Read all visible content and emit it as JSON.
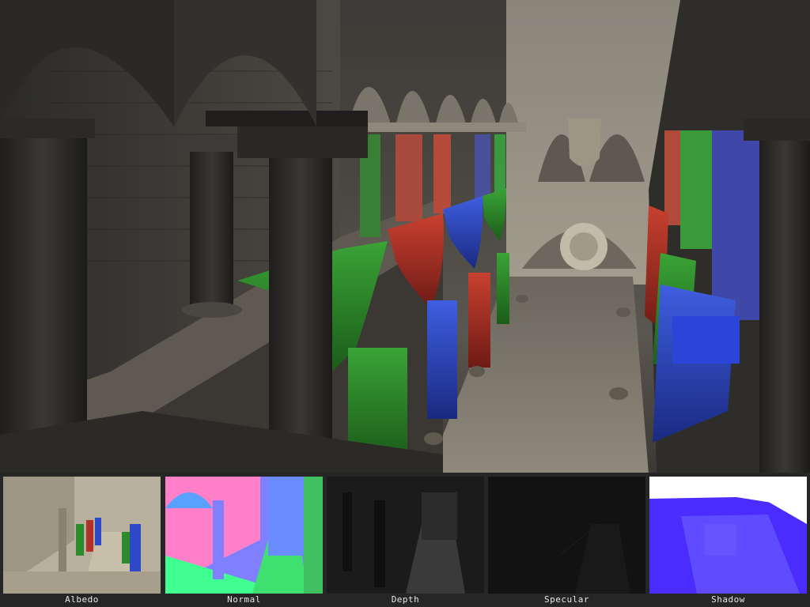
{
  "scene": {
    "banner_colors": [
      "#2f8f2c",
      "#b8322a",
      "#2d49c8"
    ]
  },
  "gbuffer": {
    "panels": [
      {
        "label": "Albedo"
      },
      {
        "label": "Normal"
      },
      {
        "label": "Depth"
      },
      {
        "label": "Specular"
      },
      {
        "label": "Shadow"
      }
    ]
  }
}
